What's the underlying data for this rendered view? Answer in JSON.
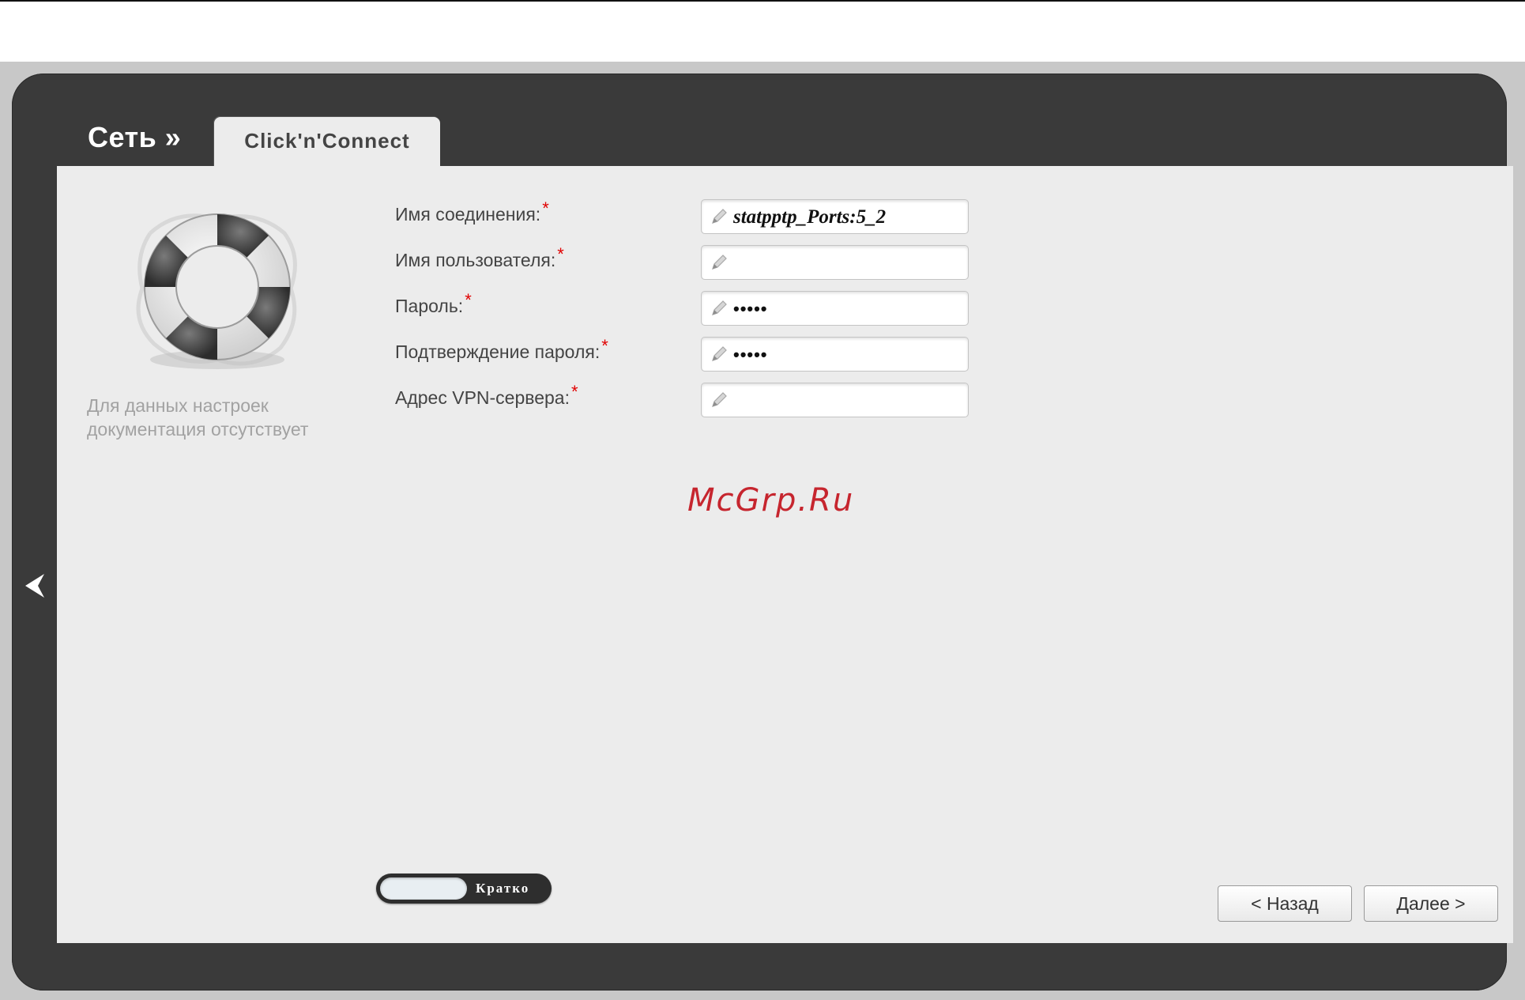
{
  "header": {
    "breadcrumb_root": "Сеть »",
    "active_tab": "Click'n'Connect"
  },
  "help": {
    "note": "Для данных настроек документация отсутствует",
    "icon": "lifebuoy-icon"
  },
  "form": {
    "fields": [
      {
        "label": "Имя соединения:",
        "required": "*",
        "value": "statpptp_Ports:5_2"
      },
      {
        "label": "Имя пользователя:",
        "required": "*",
        "value": ""
      },
      {
        "label": "Пароль:",
        "required": "*",
        "value": "•••••"
      },
      {
        "label": "Подтверждение пароля:",
        "required": "*",
        "value": "•••••"
      },
      {
        "label": "Адрес VPN-сервера:",
        "required": "*",
        "value": ""
      }
    ]
  },
  "watermark": "McGrp.Ru",
  "toggle": {
    "label": "Кратко"
  },
  "buttons": {
    "back": "< Назад",
    "next": "Далее >"
  },
  "colors": {
    "frame": "#3a3a3a",
    "panel": "#ececec",
    "required": "#e00000",
    "watermark": "#c6252e"
  }
}
